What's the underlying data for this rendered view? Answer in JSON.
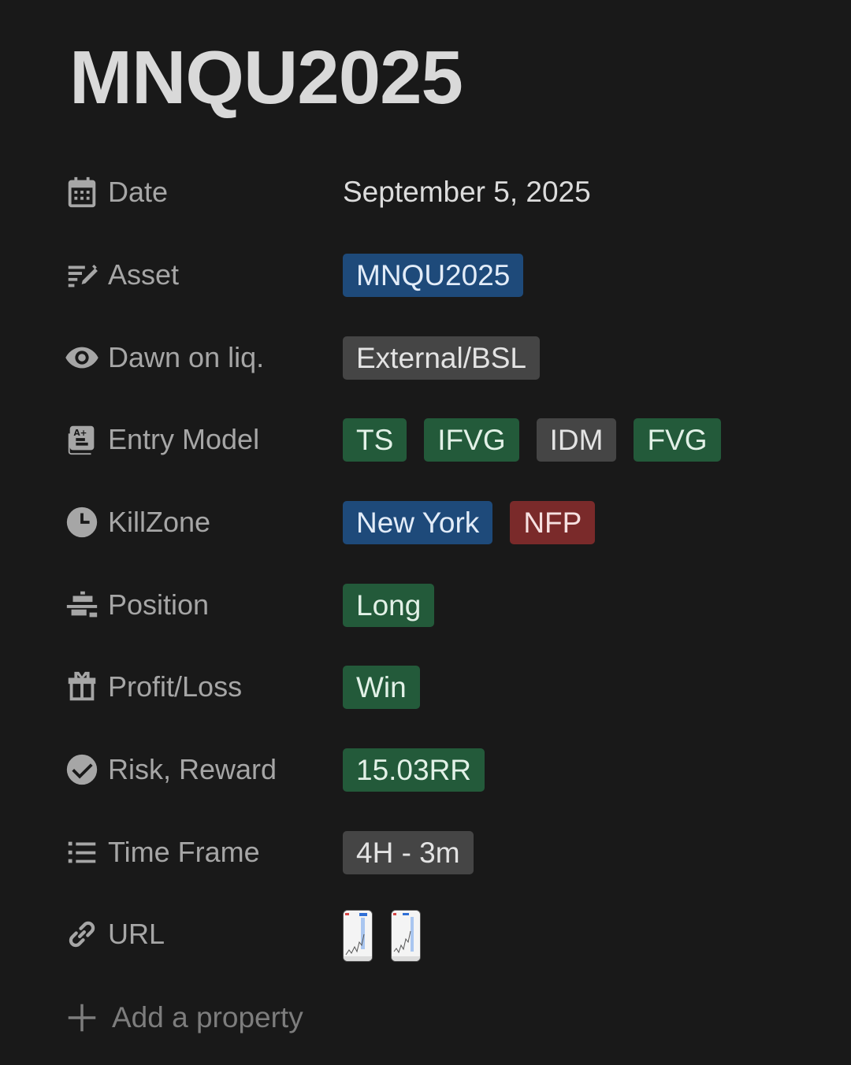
{
  "page": {
    "title": "MNQU2025"
  },
  "properties": {
    "date": {
      "label": "Date",
      "icon": "calendar-icon",
      "value": "September 5, 2025"
    },
    "asset": {
      "label": "Asset",
      "icon": "edit-list-icon",
      "tags": [
        {
          "text": "MNQU2025",
          "color": "#1e4a7a"
        }
      ]
    },
    "liquidity": {
      "label": "Dawn on liq.",
      "icon": "eye-icon",
      "tags": [
        {
          "text": "External/BSL",
          "color": "#454545"
        }
      ]
    },
    "entry_model": {
      "label": "Entry Model",
      "icon": "grade-document-icon",
      "tags": [
        {
          "text": "TS",
          "color": "#235a3a"
        },
        {
          "text": "IFVG",
          "color": "#235a3a"
        },
        {
          "text": "IDM",
          "color": "#454545"
        },
        {
          "text": "FVG",
          "color": "#235a3a"
        }
      ]
    },
    "killzone": {
      "label": "KillZone",
      "icon": "clock-icon",
      "tags": [
        {
          "text": "New York",
          "color": "#1e4a7a"
        },
        {
          "text": "NFP",
          "color": "#7a2a2a"
        }
      ]
    },
    "position": {
      "label": "Position",
      "icon": "align-bars-icon",
      "tags": [
        {
          "text": "Long",
          "color": "#235a3a"
        }
      ]
    },
    "profit_loss": {
      "label": "Profit/Loss",
      "icon": "gift-icon",
      "tags": [
        {
          "text": "Win",
          "color": "#235a3a"
        }
      ]
    },
    "risk_reward": {
      "label": "Risk, Reward",
      "icon": "check-circle-icon",
      "tags": [
        {
          "text": "15.03RR",
          "color": "#235a3a"
        }
      ]
    },
    "time_frame": {
      "label": "Time Frame",
      "icon": "list-icon",
      "tags": [
        {
          "text": "4H - 3m",
          "color": "#454545"
        }
      ]
    },
    "url": {
      "label": "URL",
      "icon": "link-icon",
      "thumbnails": [
        "chart-thumbnail",
        "chart-thumbnail"
      ]
    }
  },
  "add_property": {
    "label": "Add a property",
    "icon": "plus-icon"
  }
}
